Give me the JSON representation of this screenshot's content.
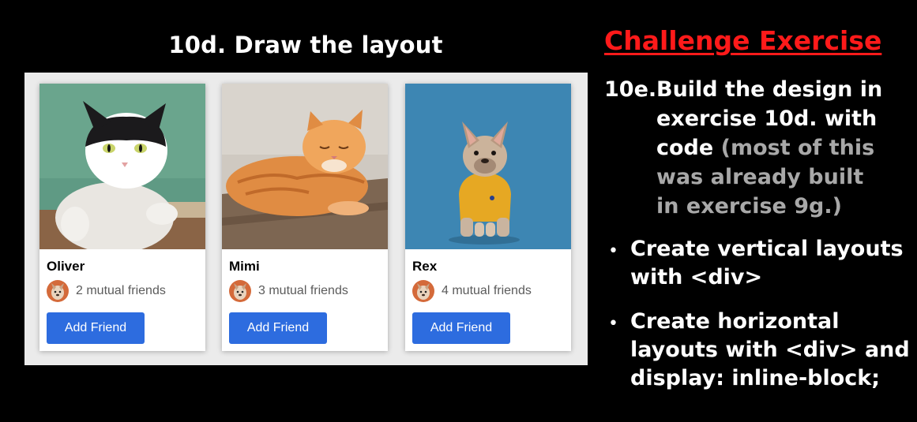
{
  "left": {
    "title": "10d. Draw the layout",
    "cards": [
      {
        "name": "Oliver",
        "mutual": "2 mutual friends",
        "button": "Add Friend"
      },
      {
        "name": "Mimi",
        "mutual": "3 mutual friends",
        "button": "Add Friend"
      },
      {
        "name": "Rex",
        "mutual": "4 mutual friends",
        "button": "Add Friend"
      }
    ]
  },
  "right": {
    "challenge": "Challenge Exercise",
    "exercise_num": "10e.",
    "exercise_lines": [
      {
        "text": "Build the design in",
        "tone": "white"
      },
      {
        "text": "exercise 10d. with",
        "tone": "white"
      },
      {
        "text": "code",
        "tone": "white"
      },
      {
        "text": "(most of this",
        "tone": "grey"
      },
      {
        "text": "was already built",
        "tone": "grey"
      },
      {
        "text": "in exercise 9g.)",
        "tone": "grey"
      }
    ],
    "bullet_1": [
      "Create vertical layouts",
      "with <div>"
    ],
    "bullet_2": [
      "Create horizontal",
      "layouts with <div> and",
      "display: inline-block;"
    ],
    "bullet_symbol": "•"
  },
  "colors": {
    "background": "#000000",
    "panel": "#ebebeb",
    "button": "#2d6cdf",
    "challenge_red": "#ff1a1a",
    "grey_text": "#a8a8a8"
  },
  "icons": [
    "cat-photo-oliver",
    "cat-photo-mimi",
    "dog-photo-rex",
    "dog-avatar-icon"
  ]
}
